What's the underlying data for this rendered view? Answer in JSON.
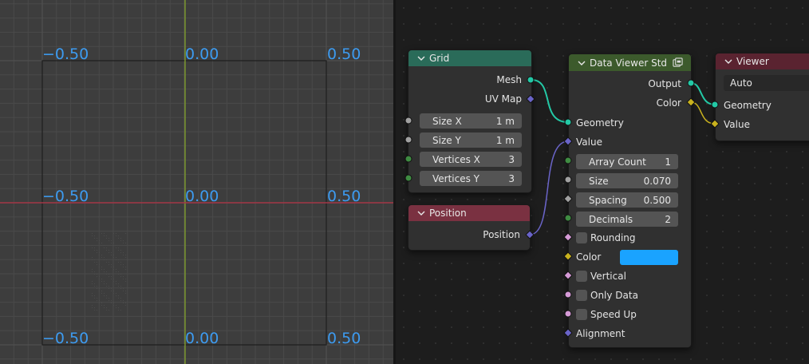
{
  "viewport": {
    "labels_row1": [
      "−0.50",
      "0.00",
      "0.50"
    ],
    "labels_row2": [
      "−0.50",
      "0.00",
      "0.50"
    ],
    "labels_row3": [
      "−0.50",
      "0.00",
      "0.50"
    ],
    "label_color": "#3d9bf0"
  },
  "nodes": {
    "grid": {
      "title": "Grid",
      "header_color": "#2a6b59",
      "outputs": [
        "Mesh",
        "UV Map"
      ],
      "fields": [
        {
          "label": "Size X",
          "value": "1 m"
        },
        {
          "label": "Size Y",
          "value": "1 m"
        },
        {
          "label": "Vertices X",
          "value": "3"
        },
        {
          "label": "Vertices Y",
          "value": "3"
        }
      ]
    },
    "position": {
      "title": "Position",
      "header_color": "#7a3141",
      "outputs": [
        "Position"
      ]
    },
    "data_viewer": {
      "title": "Data Viewer Std",
      "header_color": "#3c5a2c",
      "outputs": [
        "Output",
        "Color"
      ],
      "inputs": [
        "Geometry",
        "Value"
      ],
      "fields": [
        {
          "label": "Array Count",
          "value": "1"
        },
        {
          "label": "Size",
          "value": "0.070"
        },
        {
          "label": "Spacing",
          "value": "0.500"
        },
        {
          "label": "Decimals",
          "value": "2"
        }
      ],
      "checkboxes": [
        "Rounding",
        "Vertical",
        "Only Data",
        "Speed Up"
      ],
      "color_label": "Color",
      "color_value": "#1aa3ff",
      "alignment_label": "Alignment"
    },
    "viewer": {
      "title": "Viewer",
      "header_color": "#5a2330",
      "dropdown_value": "Auto",
      "inputs": [
        "Geometry",
        "Value"
      ]
    }
  }
}
